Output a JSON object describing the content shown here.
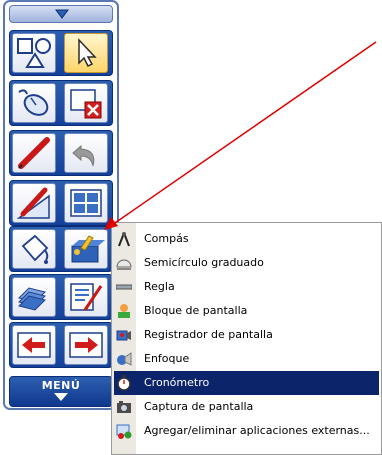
{
  "toolbar": {
    "menu_label": "MENÚ",
    "accent": "#14409a",
    "buttons": [
      {
        "name": "shapes-icon"
      },
      {
        "name": "select-arrow-icon"
      },
      {
        "name": "mouse-icon"
      },
      {
        "name": "clear-screen-icon"
      },
      {
        "name": "pen-icon"
      },
      {
        "name": "undo-icon"
      },
      {
        "name": "highlighter-icon"
      },
      {
        "name": "page-sorter-icon"
      },
      {
        "name": "paint-bucket-icon"
      },
      {
        "name": "tools-box-icon"
      },
      {
        "name": "background-pages-icon"
      },
      {
        "name": "settings-icon"
      },
      {
        "name": "previous-page-icon"
      },
      {
        "name": "next-page-icon"
      }
    ]
  },
  "context_menu": {
    "items": [
      {
        "label": "Compás",
        "icon": "compass-icon",
        "selected": false
      },
      {
        "label": "Semicírculo graduado",
        "icon": "protractor-icon",
        "selected": false
      },
      {
        "label": "Regla",
        "icon": "ruler-icon",
        "selected": false
      },
      {
        "label": "Bloque de pantalla",
        "icon": "screen-shade-icon",
        "selected": false
      },
      {
        "label": "Registrador de pantalla",
        "icon": "screen-recorder-icon",
        "selected": false
      },
      {
        "label": "Enfoque",
        "icon": "spotlight-icon",
        "selected": false
      },
      {
        "label": "Cronómetro",
        "icon": "stopwatch-icon",
        "selected": true
      },
      {
        "label": "Captura de pantalla",
        "icon": "camera-icon",
        "selected": false
      },
      {
        "label": "Agregar/eliminar aplicaciones externas...",
        "icon": "add-remove-apps-icon",
        "selected": false
      }
    ],
    "selection_color": "#0b246a"
  },
  "annotation": {
    "arrow_color": "#e00000"
  }
}
